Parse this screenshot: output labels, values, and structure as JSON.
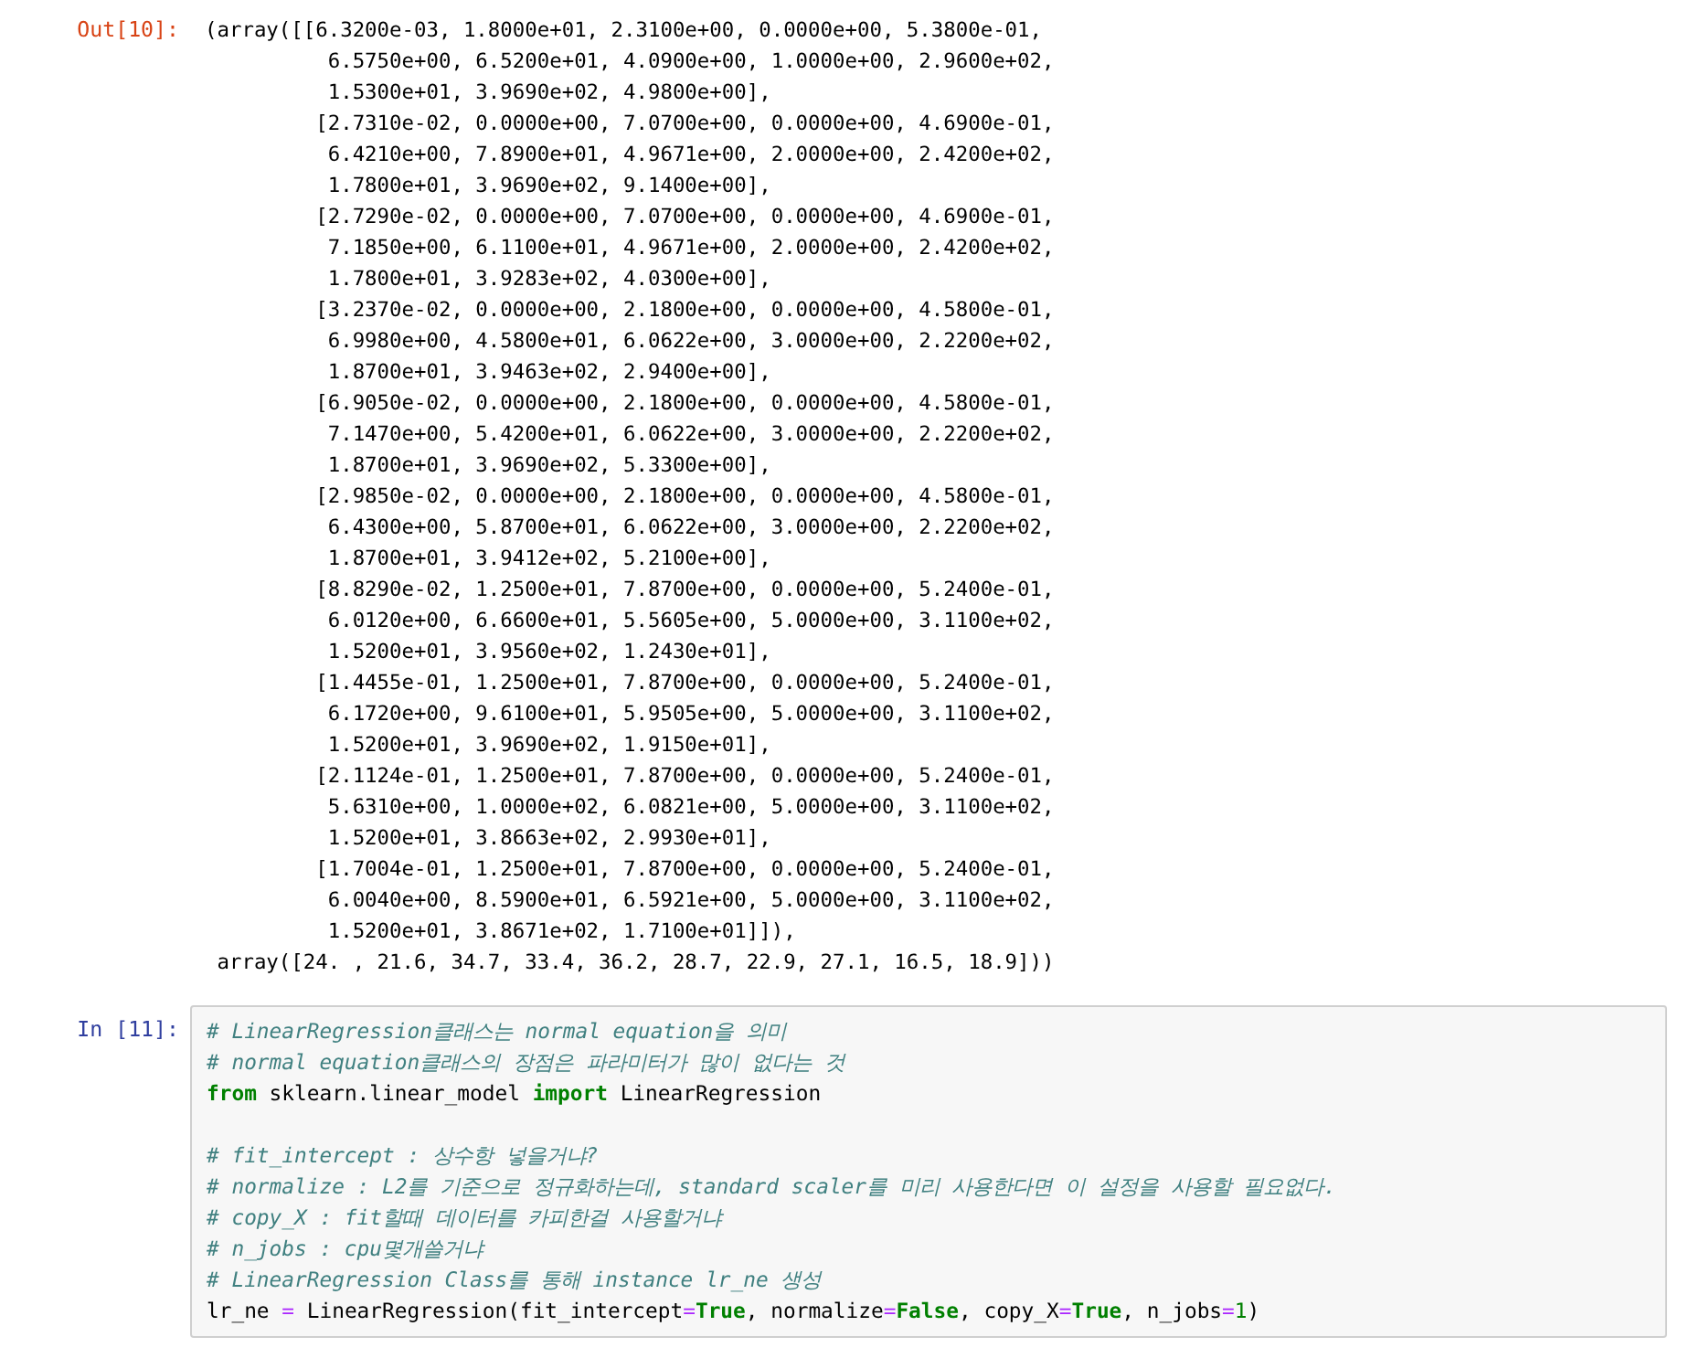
{
  "output_cell": {
    "prompt": "Out[10]:",
    "lines": [
      "(array([[6.3200e-03, 1.8000e+01, 2.3100e+00, 0.0000e+00, 5.3800e-01,",
      "          6.5750e+00, 6.5200e+01, 4.0900e+00, 1.0000e+00, 2.9600e+02,",
      "          1.5300e+01, 3.9690e+02, 4.9800e+00],",
      "         [2.7310e-02, 0.0000e+00, 7.0700e+00, 0.0000e+00, 4.6900e-01,",
      "          6.4210e+00, 7.8900e+01, 4.9671e+00, 2.0000e+00, 2.4200e+02,",
      "          1.7800e+01, 3.9690e+02, 9.1400e+00],",
      "         [2.7290e-02, 0.0000e+00, 7.0700e+00, 0.0000e+00, 4.6900e-01,",
      "          7.1850e+00, 6.1100e+01, 4.9671e+00, 2.0000e+00, 2.4200e+02,",
      "          1.7800e+01, 3.9283e+02, 4.0300e+00],",
      "         [3.2370e-02, 0.0000e+00, 2.1800e+00, 0.0000e+00, 4.5800e-01,",
      "          6.9980e+00, 4.5800e+01, 6.0622e+00, 3.0000e+00, 2.2200e+02,",
      "          1.8700e+01, 3.9463e+02, 2.9400e+00],",
      "         [6.9050e-02, 0.0000e+00, 2.1800e+00, 0.0000e+00, 4.5800e-01,",
      "          7.1470e+00, 5.4200e+01, 6.0622e+00, 3.0000e+00, 2.2200e+02,",
      "          1.8700e+01, 3.9690e+02, 5.3300e+00],",
      "         [2.9850e-02, 0.0000e+00, 2.1800e+00, 0.0000e+00, 4.5800e-01,",
      "          6.4300e+00, 5.8700e+01, 6.0622e+00, 3.0000e+00, 2.2200e+02,",
      "          1.8700e+01, 3.9412e+02, 5.2100e+00],",
      "         [8.8290e-02, 1.2500e+01, 7.8700e+00, 0.0000e+00, 5.2400e-01,",
      "          6.0120e+00, 6.6600e+01, 5.5605e+00, 5.0000e+00, 3.1100e+02,",
      "          1.5200e+01, 3.9560e+02, 1.2430e+01],",
      "         [1.4455e-01, 1.2500e+01, 7.8700e+00, 0.0000e+00, 5.2400e-01,",
      "          6.1720e+00, 9.6100e+01, 5.9505e+00, 5.0000e+00, 3.1100e+02,",
      "          1.5200e+01, 3.9690e+02, 1.9150e+01],",
      "         [2.1124e-01, 1.2500e+01, 7.8700e+00, 0.0000e+00, 5.2400e-01,",
      "          5.6310e+00, 1.0000e+02, 6.0821e+00, 5.0000e+00, 3.1100e+02,",
      "          1.5200e+01, 3.8663e+02, 2.9930e+01],",
      "         [1.7004e-01, 1.2500e+01, 7.8700e+00, 0.0000e+00, 5.2400e-01,",
      "          6.0040e+00, 8.5900e+01, 6.5921e+00, 5.0000e+00, 3.1100e+02,",
      "          1.5200e+01, 3.8671e+02, 1.7100e+01]]),",
      " array([24. , 21.6, 34.7, 33.4, 36.2, 28.7, 22.9, 27.1, 16.5, 18.9]))"
    ]
  },
  "input_cell": {
    "prompt": "In [11]:",
    "lines": [
      {
        "kind": "code",
        "tokens": [
          {
            "kind": "comment",
            "text": "# LinearRegression클래스는 normal equation을 의미"
          }
        ]
      },
      {
        "kind": "code",
        "tokens": [
          {
            "kind": "comment",
            "text": "# normal equation클래스의 장점은 파라미터가 많이 없다는 것"
          }
        ]
      },
      {
        "kind": "code",
        "tokens": [
          {
            "kind": "keyword",
            "text": "from"
          },
          {
            "kind": "name",
            "text": " sklearn.linear_model "
          },
          {
            "kind": "keyword",
            "text": "import"
          },
          {
            "kind": "name",
            "text": " LinearRegression"
          }
        ]
      },
      {
        "kind": "blank"
      },
      {
        "kind": "code",
        "tokens": [
          {
            "kind": "comment",
            "text": "# fit_intercept : 상수항 넣을거냐?"
          }
        ]
      },
      {
        "kind": "code",
        "tokens": [
          {
            "kind": "comment",
            "text": "# normalize : L2를 기준으로 정규화하는데, standard scaler를 미리 사용한다면 이 설정을 사용할 필요없다."
          }
        ]
      },
      {
        "kind": "code",
        "tokens": [
          {
            "kind": "comment",
            "text": "# copy_X : fit할때 데이터를 카피한걸 사용할거냐"
          }
        ]
      },
      {
        "kind": "code",
        "tokens": [
          {
            "kind": "comment",
            "text": "# n_jobs : cpu몇개쓸거냐"
          }
        ]
      },
      {
        "kind": "code",
        "tokens": [
          {
            "kind": "comment",
            "text": "# LinearRegression Class를 통해 instance lr_ne 생성"
          }
        ]
      },
      {
        "kind": "code",
        "tokens": [
          {
            "kind": "name",
            "text": "lr_ne "
          },
          {
            "kind": "operator",
            "text": "="
          },
          {
            "kind": "name",
            "text": " LinearRegression(fit_intercept"
          },
          {
            "kind": "operator",
            "text": "="
          },
          {
            "kind": "keyword",
            "text": "True"
          },
          {
            "kind": "name",
            "text": ", normalize"
          },
          {
            "kind": "operator",
            "text": "="
          },
          {
            "kind": "keyword",
            "text": "False"
          },
          {
            "kind": "name",
            "text": ", copy_X"
          },
          {
            "kind": "operator",
            "text": "="
          },
          {
            "kind": "keyword",
            "text": "True"
          },
          {
            "kind": "name",
            "text": ", n_jobs"
          },
          {
            "kind": "operator",
            "text": "="
          },
          {
            "kind": "number",
            "text": "1"
          },
          {
            "kind": "name",
            "text": ")"
          }
        ]
      }
    ]
  }
}
